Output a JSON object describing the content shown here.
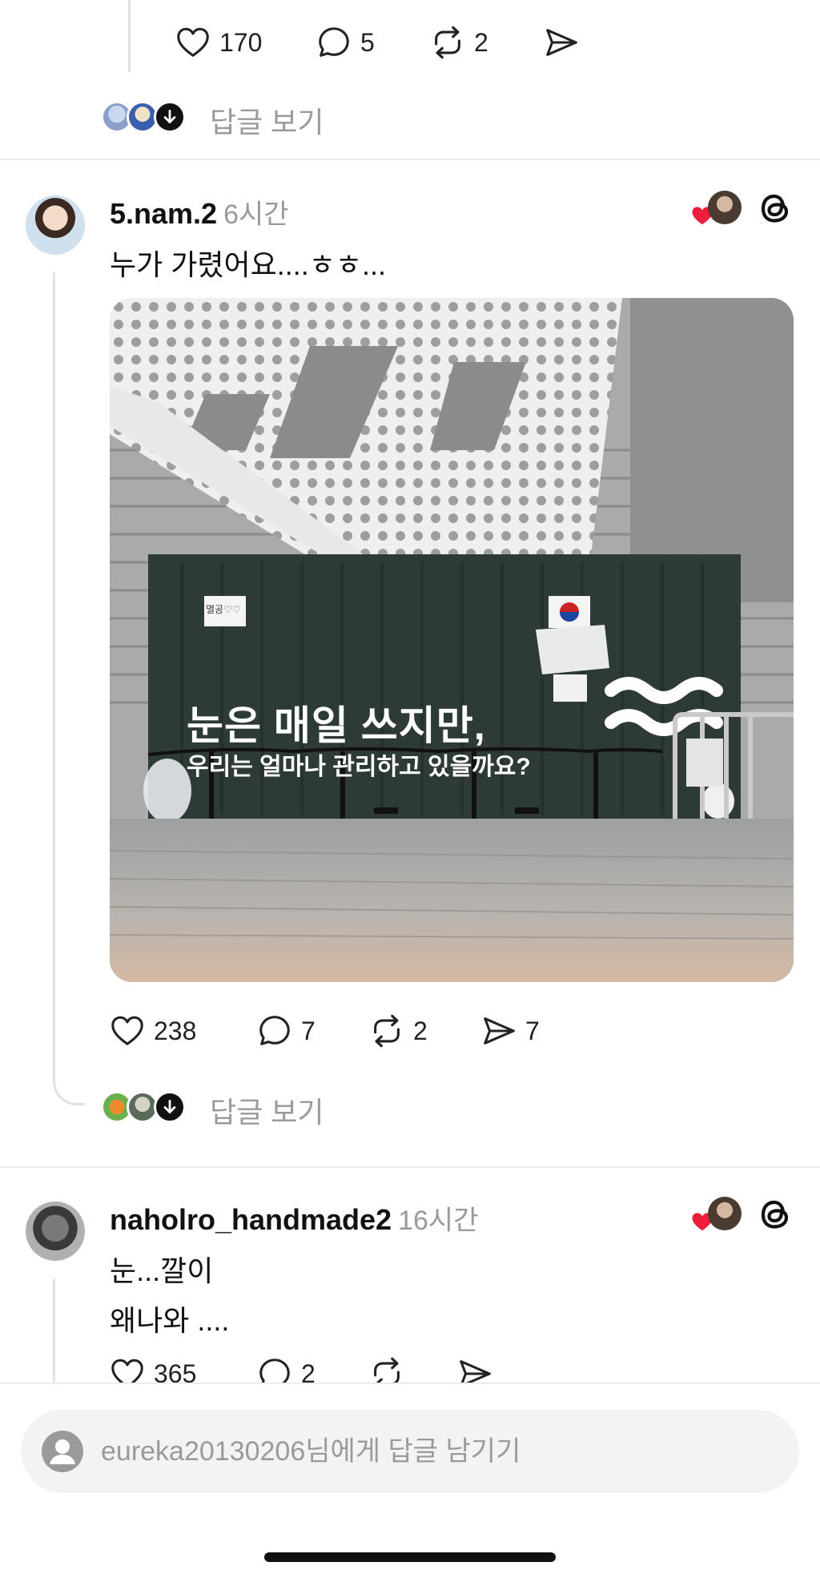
{
  "post0": {
    "likes": "170",
    "comments": "5",
    "reposts": "2",
    "view_replies": "답글 보기"
  },
  "post1": {
    "username": "5.nam.2",
    "time": "6시간",
    "text": "누가 가렸어요....ㅎㅎ...",
    "image": {
      "sign_line1": "눈은 매일 쓰지만,",
      "sign_line2": "우리는 얼마나 관리하고 있을까요?",
      "paper_note": "멸공♡♡"
    },
    "likes": "238",
    "comments": "7",
    "reposts": "2",
    "shares": "7",
    "view_replies": "답글 보기"
  },
  "post2": {
    "username": "naholro_handmade2",
    "time": "16시간",
    "text_line1": "눈...깔이",
    "text_line2": "왜나와 ....",
    "likes": "365",
    "comments": "2"
  },
  "reply_bar": {
    "placeholder": "eureka20130206님에게 답글 남기기"
  },
  "icons": {
    "like": "heart-icon",
    "comment": "comment-bubble-icon",
    "repost": "repost-icon",
    "share": "send-icon",
    "threads": "threads-logo-icon",
    "liked_badge": "red-heart-icon"
  },
  "colors": {
    "text": "#111111",
    "muted": "#9a9a9a",
    "heart_red": "#ee1d3c",
    "divider": "#ececec",
    "container_green": "#2e3a36"
  }
}
